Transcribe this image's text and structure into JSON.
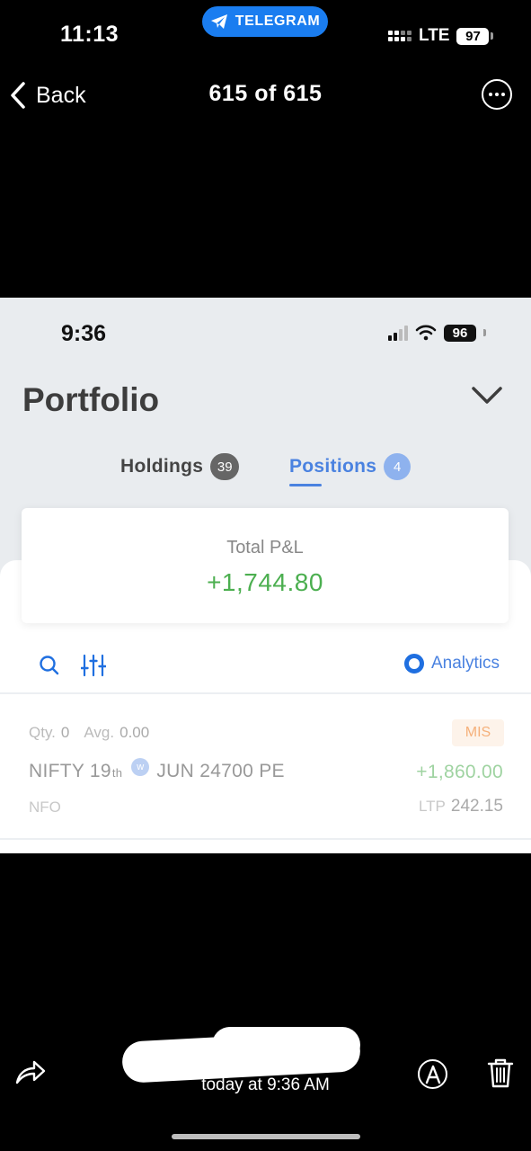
{
  "outer_status": {
    "time": "11:13",
    "app_pill": "TELEGRAM",
    "network": "LTE",
    "battery": "97"
  },
  "viewer": {
    "back_label": "Back",
    "counter": "615 of 615",
    "caption_time": "today at 9:36 AM"
  },
  "inner_status": {
    "time": "9:36",
    "battery": "96"
  },
  "portfolio": {
    "title": "Portfolio",
    "tabs": [
      {
        "label": "Holdings",
        "count": "39",
        "active": false
      },
      {
        "label": "Positions",
        "count": "4",
        "active": true
      }
    ],
    "total_pnl_label": "Total P&L",
    "total_pnl_value": "+1,744.80",
    "analytics_label": "Analytics"
  },
  "position": {
    "qty_label": "Qty.",
    "qty_value": "0",
    "avg_label": "Avg.",
    "avg_value": "0.00",
    "product": "MIS",
    "symbol": "NIFTY 19",
    "symbol_sup": "th",
    "weekly_marker": "w",
    "contract": "JUN 24700 PE",
    "pnl": "+1,860.00",
    "exchange": "NFO",
    "ltp_label": "LTP",
    "ltp_value": "242.15"
  },
  "colors": {
    "accent_blue": "#4a82e0",
    "profit_green": "#4caf50",
    "telegram_blue": "#1a7df0"
  },
  "icons": [
    "chevron-left-icon",
    "more-icon",
    "telegram-icon",
    "chevron-down-icon",
    "search-icon",
    "sliders-icon",
    "analytics-icon",
    "share-icon",
    "markup-icon",
    "trash-icon"
  ]
}
